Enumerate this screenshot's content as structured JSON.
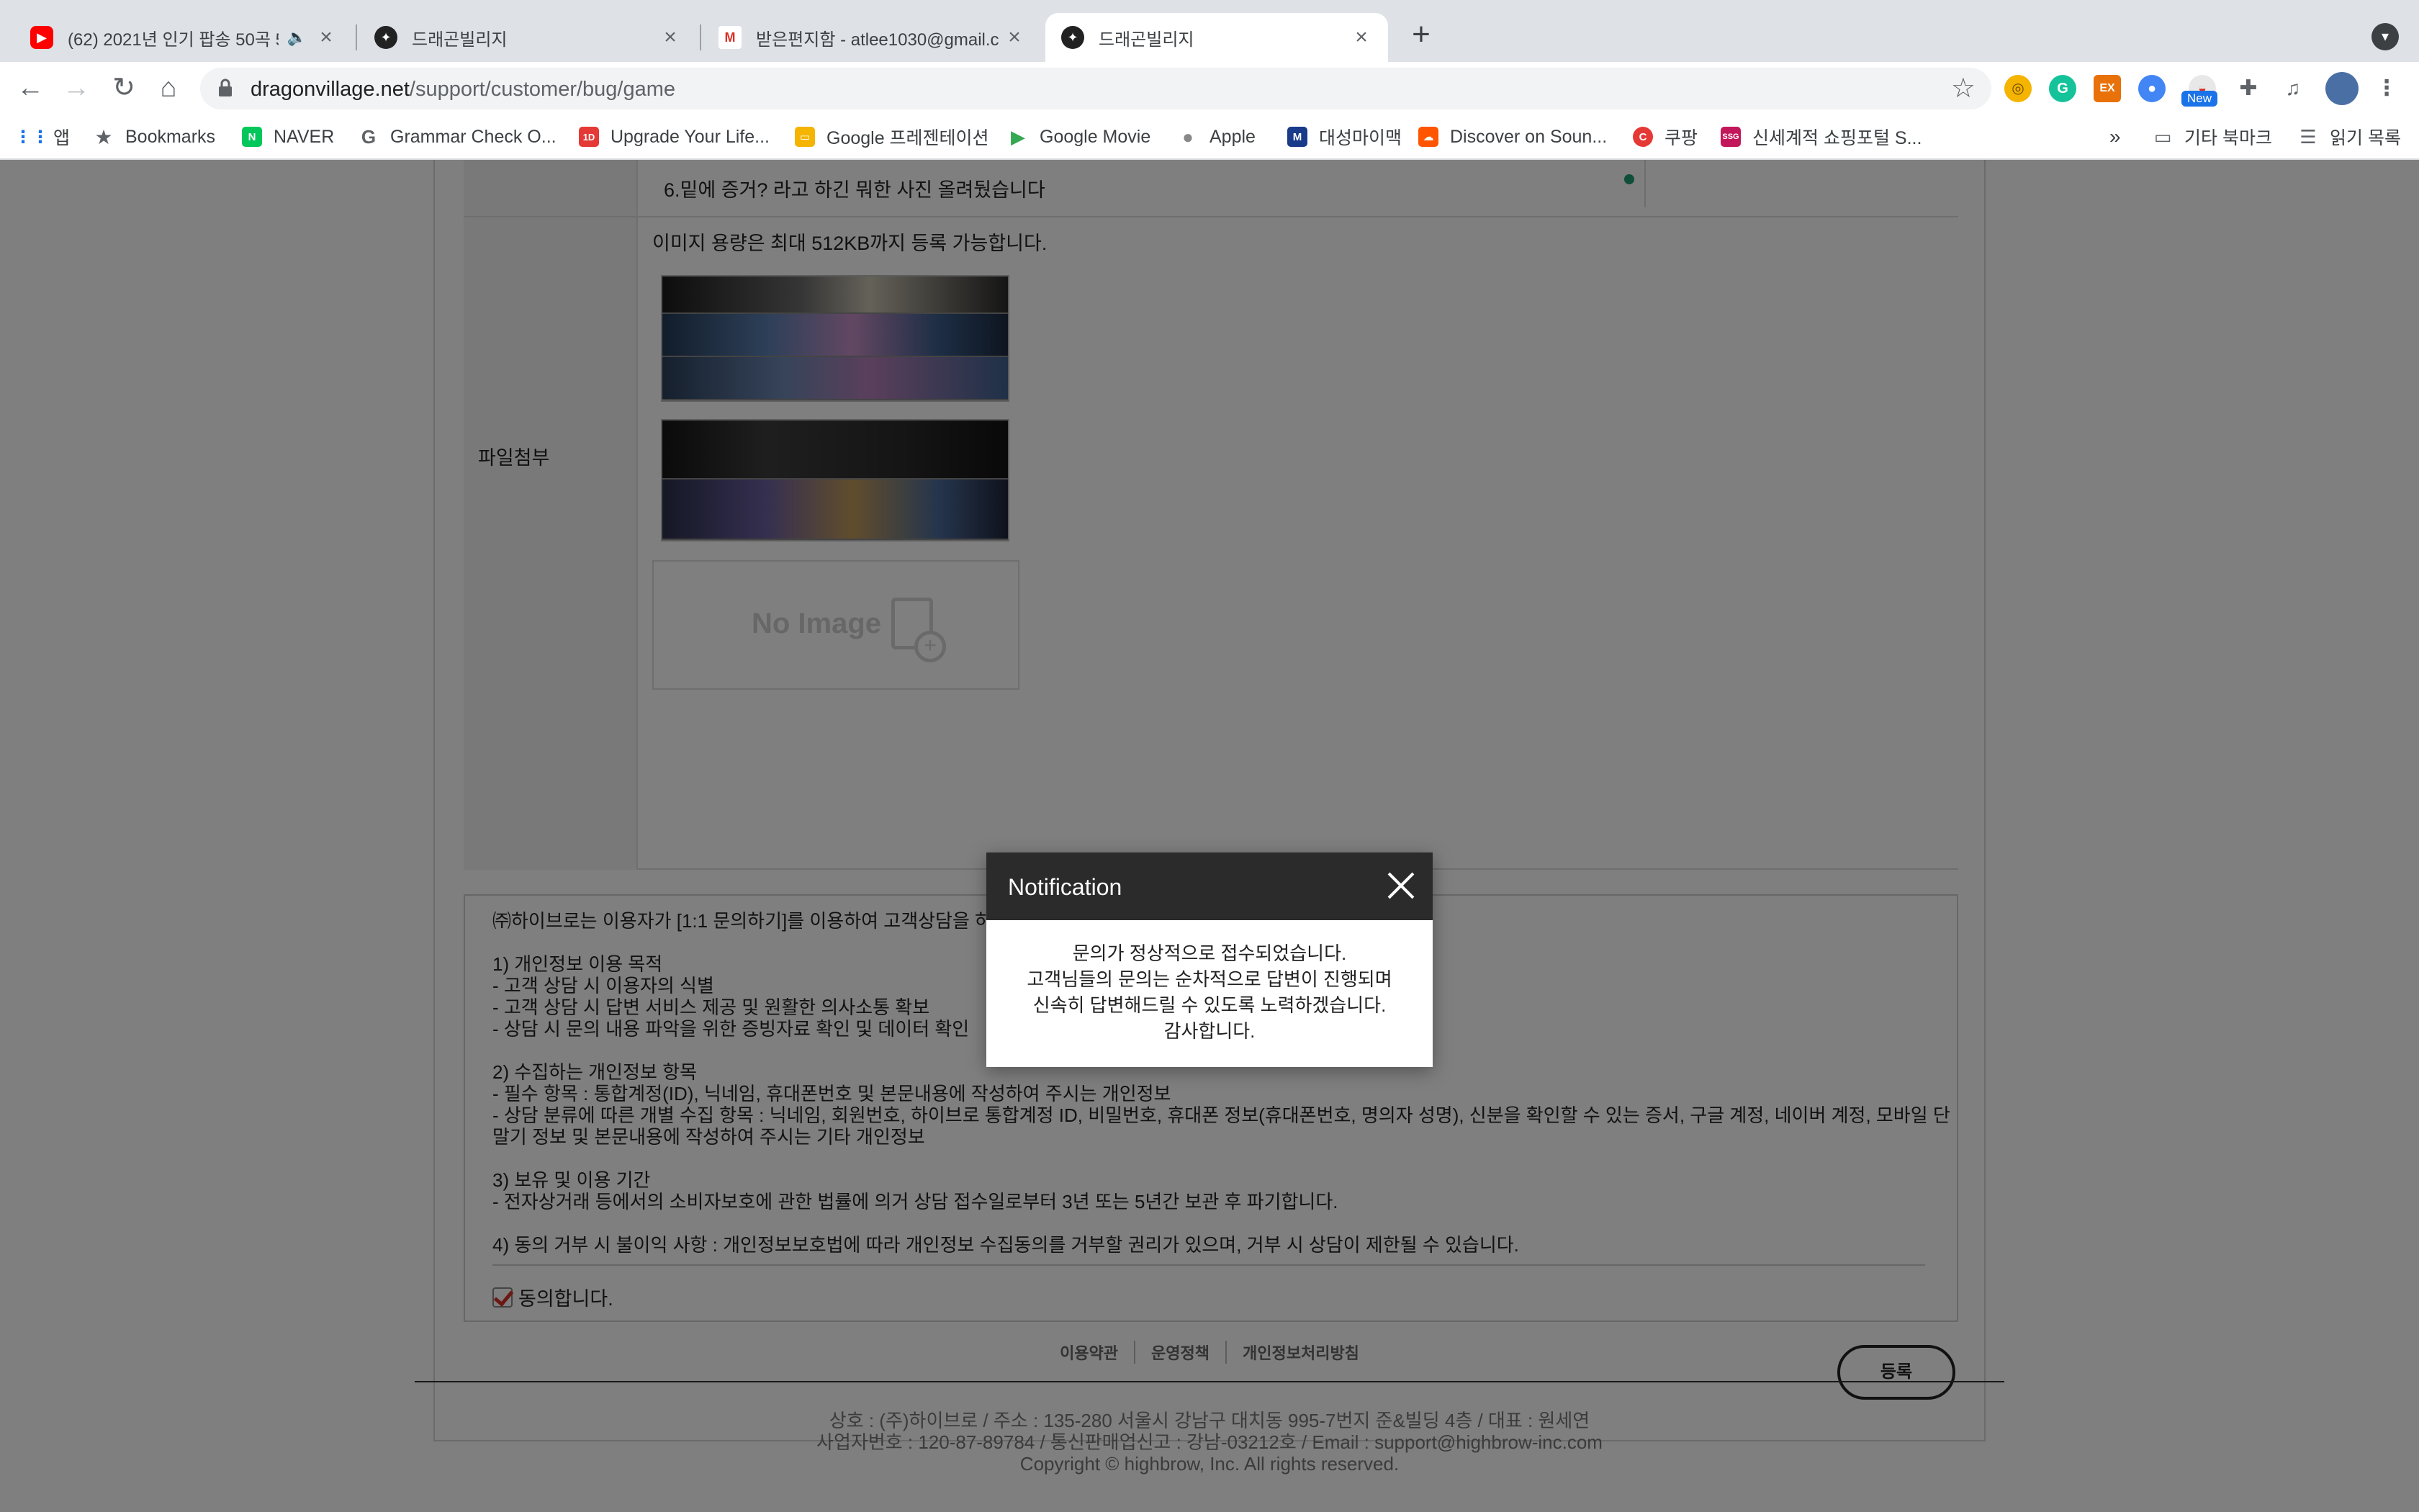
{
  "browser": {
    "tabs": [
      {
        "title": "(62) 2021년 인기 팝송 50곡 5",
        "favicon": "youtube-icon",
        "playing": true
      },
      {
        "title": "드래곤빌리지",
        "favicon": "dragonvillage-icon"
      },
      {
        "title": "받은편지함 - atlee1030@gmail.c",
        "favicon": "gmail-icon"
      },
      {
        "title": "드래곤빌리지",
        "favicon": "dragonvillage-icon",
        "active": true
      }
    ],
    "url_domain": "dragonvillage.net",
    "url_path": "/support/customer/bug/game",
    "extension_badge": "New",
    "bookmarks": [
      {
        "label": "앱",
        "icon": "apps-grid-icon"
      },
      {
        "label": "Bookmarks",
        "icon": "star-icon"
      },
      {
        "label": "NAVER",
        "icon": "naver-icon"
      },
      {
        "label": "Grammar Check O...",
        "icon": "grammar-icon"
      },
      {
        "label": "Upgrade Your Life...",
        "icon": "upgrade-icon"
      },
      {
        "label": "Google 프레젠테이션",
        "icon": "slides-icon"
      },
      {
        "label": "Google Movie",
        "icon": "play-icon"
      },
      {
        "label": "Apple",
        "icon": "apple-icon"
      },
      {
        "label": "대성마이맥",
        "icon": "mimac-icon"
      },
      {
        "label": "Discover on Soun...",
        "icon": "soundcloud-icon"
      },
      {
        "label": "쿠팡",
        "icon": "coupang-icon"
      },
      {
        "label": "신세계적 쇼핑포털 S...",
        "icon": "ssg-icon"
      }
    ],
    "bookmarks_overflow": "»",
    "other_bookmarks": "기타 북마크",
    "reading_list": "읽기 목록"
  },
  "form": {
    "content_last_line": "6.밑에 증거? 라고 하긴 뭐한 사진 올려뒀습니다",
    "attachment_label": "파일첨부",
    "attachment_note": "이미지 용량은 최대 512KB까지 등록 가능합니다.",
    "no_image_label": "No Image"
  },
  "privacy": {
    "intro": "㈜하이브로는 이용자가 [1:1 문의하기]를 이용하여 고객상담을 하",
    "lines": [
      "1) 개인정보 이용 목적",
      "- 고객 상담 시 이용자의 식별",
      "- 고객 상담 시 답변 서비스 제공 및 원활한 의사소통 확보",
      "- 상담 시 문의 내용 파악을 위한 증빙자료 확인 및 데이터 확인",
      "",
      "2) 수집하는 개인정보 항목",
      "- 필수 항목 : 통합계정(ID), 닉네임, 휴대폰번호 및 본문내용에 작성하여 주시는 개인정보",
      "- 상담 분류에 따른 개별 수집 항목 : 닉네임, 회원번호, 하이브로 통합계정 ID, 비밀번호, 휴대폰 정보(휴대폰번호, 명의자 성명), 신분을 확인할 수 있는 증서, 구글 계정, 네이버 계정, 모바일 단",
      "말기 정보 및 본문내용에 작성하여 주시는 기타 개인정보",
      "",
      "3) 보유 및 이용 기간",
      "- 전자상거래 등에서의 소비자보호에 관한 법률에 의거 상담 접수일로부터 3년 또는 5년간 보관 후 파기합니다.",
      "",
      "4) 동의 거부 시 불이익 사항 : 개인정보보호법에 따라 개인정보 수집동의를 거부할 권리가 있으며, 거부 시 상담이 제한될 수 있습니다."
    ],
    "agree_label": "동의합니다.",
    "agree_checked": true
  },
  "submit_label": "등록",
  "footer": {
    "links": [
      "이용약관",
      "운영정책",
      "개인정보처리방침"
    ],
    "info": [
      "상호 : (주)하이브로 / 주소 : 135-280 서울시 강남구 대치동 995-7번지 준&빌딩 4층 / 대표 : 원세연",
      "사업자번호 : 120-87-89784 / 통신판매업신고 : 강남-03212호 / Email : support@highbrow-inc.com",
      "Copyright © highbrow, Inc. All rights reserved."
    ]
  },
  "modal": {
    "title": "Notification",
    "message": [
      "문의가 정상적으로 접수되었습니다.",
      "고객님들의 문의는 순차적으로 답변이 진행되며",
      "신속히 답변해드릴 수 있도록 노력하겠습니다.",
      "감사합니다."
    ]
  },
  "colors": {
    "overlay": "rgba(0,0,0,0.5)",
    "modal_header": "#2b2b2b",
    "checkbox_mark": "#d93025",
    "extension_badge": "#1a73e8"
  }
}
